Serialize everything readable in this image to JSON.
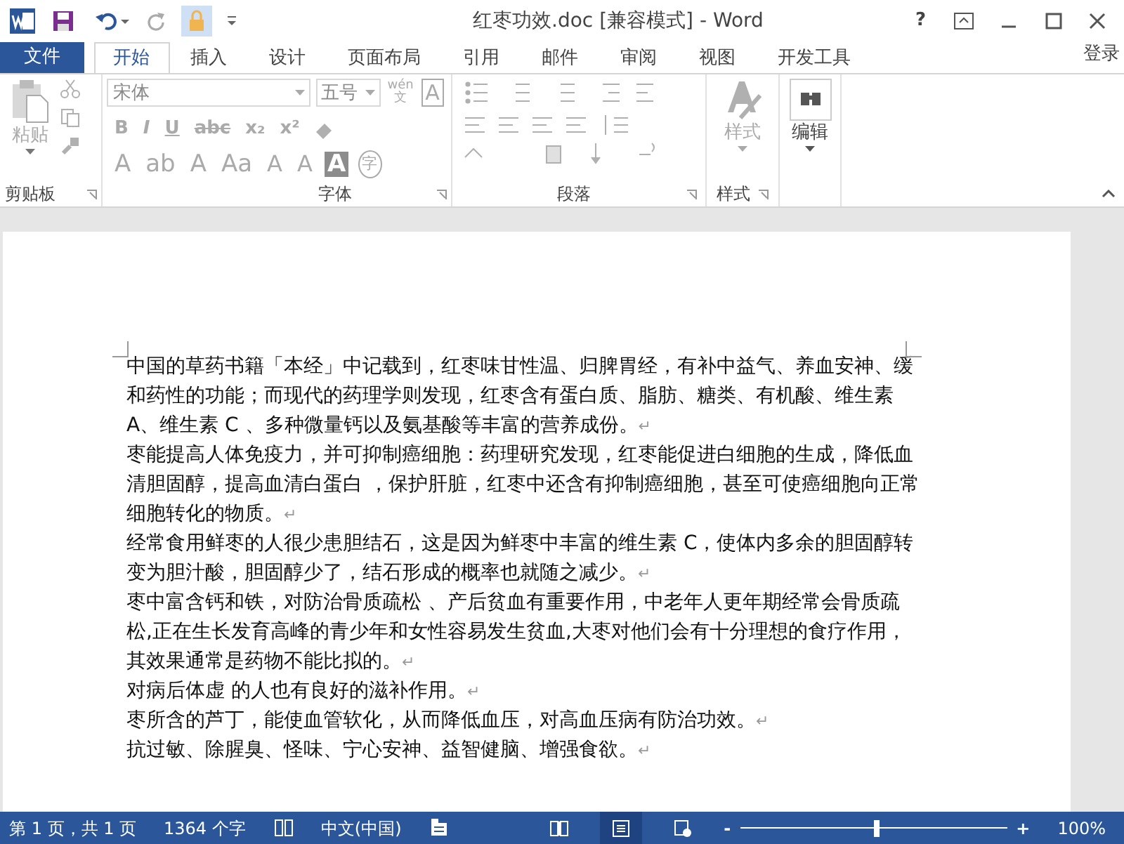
{
  "window": {
    "title": "红枣功效.doc [兼容模式] - Word",
    "help": "?"
  },
  "file_tab": "文件",
  "tabs": [
    {
      "label": "开始",
      "selected": true
    },
    {
      "label": "插入",
      "selected": false
    },
    {
      "label": "设计",
      "selected": false
    },
    {
      "label": "页面布局",
      "selected": false
    },
    {
      "label": "引用",
      "selected": false
    },
    {
      "label": "邮件",
      "selected": false
    },
    {
      "label": "审阅",
      "selected": false
    },
    {
      "label": "视图",
      "selected": false
    },
    {
      "label": "开发工具",
      "selected": false
    }
  ],
  "sign_in": "登录",
  "ribbon": {
    "disabled": true,
    "clipboard": {
      "paste": "粘贴",
      "group": "剪贴板"
    },
    "font": {
      "font_name": "宋体",
      "font_size": "五号",
      "phonetic_top": "wén",
      "phonetic_bottom": "文",
      "char_border": "A",
      "row2": [
        "B",
        "I",
        "U",
        "abc",
        "x₂",
        "x²"
      ],
      "row3": [
        "A",
        "ab",
        "A",
        "Aa",
        "A",
        "A",
        "A",
        "字"
      ],
      "group": "字体"
    },
    "paragraph": {
      "group": "段落"
    },
    "styles": {
      "button": "样式",
      "group": "样式"
    },
    "editing": {
      "button": "编辑"
    }
  },
  "page": {
    "paragraphs": [
      {
        "text": "中国的草药书籍「本经」中记载到，红枣味甘性温、归脾胃经，有补中益气、养血安神、缓和药性的功能；而现代的药理学则发现，红枣含有蛋白质、脂肪、糖类、有机酸、维生素 A、维生素 C 、多种微量钙以及氨基酸等丰富的营养成份。",
        "mark": "↵"
      },
      {
        "text": "枣能提高人体免疫力，并可抑制癌细胞：药理研究发现，红枣能促进白细胞的生成，降低血清胆固醇，提高血清白蛋白 ，保护肝脏，红枣中还含有抑制癌细胞，甚至可使癌细胞向正常细胞转化的物质。",
        "mark": "↵"
      },
      {
        "text": "经常食用鲜枣的人很少患胆结石，这是因为鲜枣中丰富的维生素 C，使体内多余的胆固醇转变为胆汁酸，胆固醇少了，结石形成的概率也就随之减少。",
        "mark": "↵"
      },
      {
        "text": "枣中富含钙和铁，对防治骨质疏松 、产后贫血有重要作用，中老年人更年期经常会骨质疏松,正在生长发育高峰的青少年和女性容易发生贫血,大枣对他们会有十分理想的食疗作用，其效果通常是药物不能比拟的。",
        "mark": "↵"
      },
      {
        "text": "对病后体虚 的人也有良好的滋补作用。",
        "mark": "↵"
      },
      {
        "text": "枣所含的芦丁，能使血管软化，从而降低血压，对高血压病有防治功效。",
        "mark": "↵"
      },
      {
        "text": "抗过敏、除腥臭、怪味、宁心安神、益智健脑、增强食欲。",
        "mark": "↵"
      }
    ]
  },
  "status_bar": {
    "page": "第 1 页，共 1 页",
    "words": "1364 个字",
    "language": "中文(中国)",
    "views": [
      {
        "selected": false
      },
      {
        "selected": true
      },
      {
        "selected": false
      }
    ],
    "zoom_out": "-",
    "zoom_in": "+",
    "zoom": {
      "level": 0.5
    },
    "zoom_text": "100%"
  }
}
